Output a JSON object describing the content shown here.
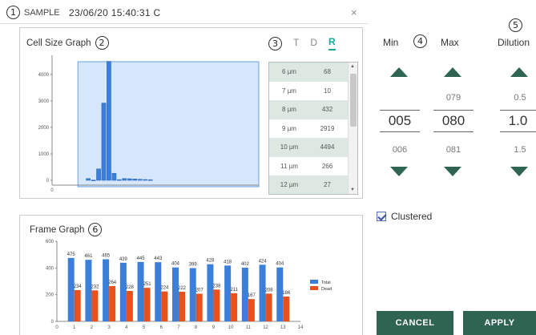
{
  "header": {
    "marker": "1",
    "sample_label": "SAMPLE",
    "timestamp": "23/06/20 15:40:31 C",
    "close_glyph": "×"
  },
  "cell_panel": {
    "title": "Cell Size Graph",
    "marker": "2",
    "tabs_marker": "3",
    "tabs": [
      {
        "label": "T",
        "active": false
      },
      {
        "label": "D",
        "active": false
      },
      {
        "label": "R",
        "active": true
      }
    ],
    "table": [
      {
        "size": "6 µm",
        "count": "68"
      },
      {
        "size": "7 µm",
        "count": "10"
      },
      {
        "size": "8 µm",
        "count": "432"
      },
      {
        "size": "9 µm",
        "count": "2919"
      },
      {
        "size": "10 µm",
        "count": "4494"
      },
      {
        "size": "11 µm",
        "count": "266"
      },
      {
        "size": "12 µm",
        "count": "27"
      }
    ]
  },
  "frame_panel": {
    "title": "Frame Graph",
    "marker": "6"
  },
  "controls": {
    "range_marker": "4",
    "dilution_marker": "5",
    "columns": [
      {
        "label": "Min",
        "above": "",
        "value": "005",
        "below": "006"
      },
      {
        "label": "Max",
        "above": "079",
        "value": "080",
        "below": "081"
      },
      {
        "label": "Dilution",
        "above": "0.5",
        "value": "1.0",
        "below": "1.5"
      }
    ]
  },
  "clustered": {
    "label": "Clustered",
    "checked": true
  },
  "buttons": {
    "cancel": "CANCEL",
    "apply": "APPLY"
  },
  "colors": {
    "accent": "#2f6452",
    "tab_active": "#1aa89c",
    "bar_blue": "#3b7fd9",
    "bar_orange": "#e8501c",
    "selection": "#d6e6fb"
  },
  "icons": {
    "up": "triangle-up-icon",
    "down": "triangle-down-icon",
    "check": "checkbox-icon"
  },
  "chart_data": [
    {
      "type": "bar",
      "title": "Cell Size Graph",
      "yticks": [
        0,
        1000,
        2000,
        3000,
        4000
      ],
      "xticks": [
        "0"
      ],
      "ylim": [
        0,
        4600
      ],
      "xlim": [
        0,
        40
      ],
      "selection_range": [
        5,
        80
      ],
      "bars": [
        {
          "x": 7,
          "value": 68
        },
        {
          "x": 8,
          "value": 10
        },
        {
          "x": 9,
          "value": 432
        },
        {
          "x": 10,
          "value": 2919
        },
        {
          "x": 11,
          "value": 4494
        },
        {
          "x": 12,
          "value": 266
        },
        {
          "x": 13,
          "value": 27
        },
        {
          "x": 14,
          "value": 70
        },
        {
          "x": 15,
          "value": 60
        },
        {
          "x": 16,
          "value": 50
        },
        {
          "x": 17,
          "value": 40
        },
        {
          "x": 18,
          "value": 30
        },
        {
          "x": 19,
          "value": 25
        }
      ]
    },
    {
      "type": "bar",
      "title": "Frame Graph",
      "categories": [
        "1",
        "2",
        "3",
        "4",
        "5",
        "6",
        "7",
        "8",
        "9",
        "10",
        "11",
        "12",
        "13"
      ],
      "xticks": [
        "0",
        "1",
        "2",
        "3",
        "4",
        "5",
        "6",
        "7",
        "8",
        "9",
        "10",
        "11",
        "12",
        "13",
        "14"
      ],
      "yticks": [
        0,
        200,
        400,
        600
      ],
      "ylim": [
        0,
        600
      ],
      "legend": "right",
      "series": [
        {
          "name": "Total",
          "values": [
            475,
            461,
            465,
            439,
            445,
            443,
            404,
            399,
            428,
            418,
            402,
            424,
            404
          ]
        },
        {
          "name": "Dead",
          "values": [
            234,
            232,
            264,
            228,
            251,
            224,
            222,
            207,
            238,
            211,
            167,
            208,
            186
          ]
        }
      ]
    }
  ]
}
